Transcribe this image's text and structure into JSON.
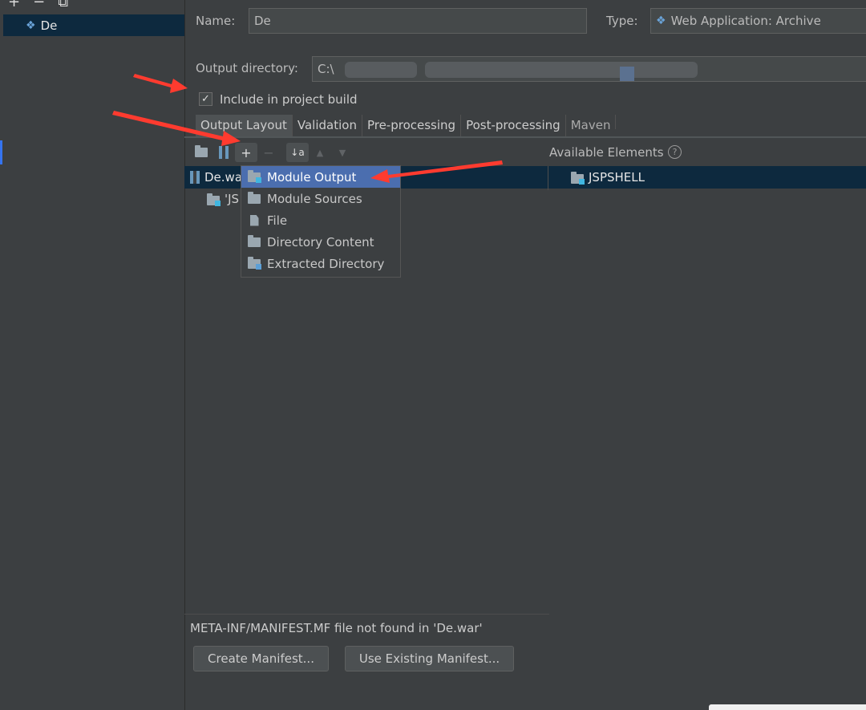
{
  "sidebar": {
    "toolbar": {
      "add": "+",
      "remove": "−",
      "copy": "⧉"
    },
    "artifact": {
      "name": "De",
      "icon": "web-app-icon"
    }
  },
  "form": {
    "name_label": "Name:",
    "name_value": "De",
    "type_label": "Type:",
    "type_value": "Web Application: Archive",
    "output_dir_label": "Output directory:",
    "output_dir_value": "C:\\",
    "include_label": "Include in project build",
    "include_checked": true
  },
  "tabs": [
    {
      "label": "Output Layout",
      "active": true
    },
    {
      "label": "Validation"
    },
    {
      "label": "Pre-processing"
    },
    {
      "label": "Post-processing"
    },
    {
      "label": "Maven"
    }
  ],
  "toolbar": {
    "add_label": "+",
    "remove_label": "−",
    "sort_label": "↓a"
  },
  "tree": {
    "root": "De.war",
    "child": "'JS"
  },
  "available": {
    "label": "Available Elements",
    "help": "?",
    "item": "JSPSHELL"
  },
  "add_menu": {
    "items": [
      {
        "label": "Module Output",
        "icon": "folder-module-icon",
        "selected": true
      },
      {
        "label": "Module Sources",
        "icon": "folder-icon"
      },
      {
        "label": "File",
        "icon": "file-icon"
      },
      {
        "label": "Directory Content",
        "icon": "folder-icon"
      },
      {
        "label": "Extracted Directory",
        "icon": "extract-folder-icon"
      }
    ]
  },
  "manifest": {
    "message": "META-INF/MANIFEST.MF file not found in 'De.war'",
    "create_label": "Create Manifest...",
    "use_existing_label": "Use Existing Manifest..."
  },
  "colors": {
    "background": "#3c3f41",
    "selection": "#0d293e",
    "accent": "#4b6eaf",
    "annotation": "#ff3b2f"
  }
}
